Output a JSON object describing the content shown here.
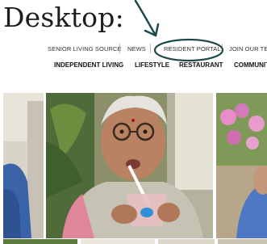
{
  "heading": "Desktop:",
  "top_nav": [
    {
      "label": "SENIOR LIVING SOURCE"
    },
    {
      "label": "NEWS"
    },
    {
      "label": "RESIDENT PORTAL"
    },
    {
      "label": "JOIN OUR TEAM"
    }
  ],
  "main_nav": [
    {
      "label": "INDEPENDENT LIVING"
    },
    {
      "label": "LIFESTYLE"
    },
    {
      "label": "RESTAURANT"
    },
    {
      "label": "COMMUNITY"
    }
  ],
  "annotation": {
    "color": "#1f4a4a"
  },
  "photos": [
    {
      "name": "left-photo"
    },
    {
      "name": "elderly-woman-drinking-photo"
    },
    {
      "name": "right-photo"
    }
  ]
}
